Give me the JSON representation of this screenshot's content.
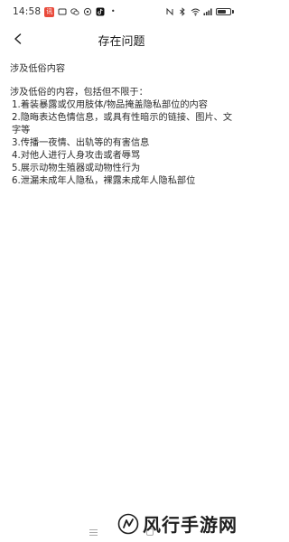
{
  "status_bar": {
    "time": "14:58",
    "battery_level": 0.72,
    "left_icons": [
      "app-badge-icon",
      "app-icon",
      "wechat-icon",
      "app-icon-2",
      "tiktok-icon",
      "more-dots-icon"
    ],
    "right_icons": [
      "nfc-icon",
      "bluetooth-icon",
      "wifi-icon",
      "signal-icon",
      "battery-icon"
    ]
  },
  "header": {
    "title": "存在问题"
  },
  "content": {
    "heading": "涉及低俗内容",
    "intro": "涉及低俗的内容，包括但不限于：",
    "rules": [
      "1.着装暴露或仅用肢体/物品掩盖隐私部位的内容",
      "2.隐晦表达色情信息，或具有性暗示的链接、图片、文字等",
      "3.传播一夜情、出轨等的有害信息",
      "4.对他人进行人身攻击或者辱骂",
      "5.展示动物生殖器或动物性行为",
      "6.泄漏未成年人隐私，裸露未成年人隐私部位"
    ]
  },
  "watermark": {
    "text": "风行手游网"
  },
  "colors": {
    "background": "#ffffff",
    "text": "#2a2a2a",
    "app_badge": "#e94b3c"
  }
}
